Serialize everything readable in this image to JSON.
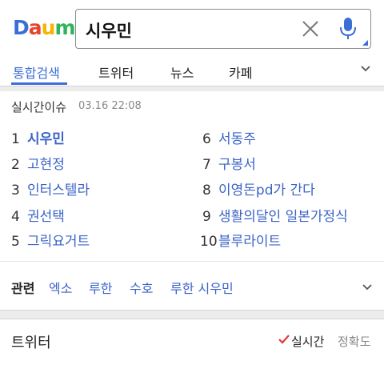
{
  "logo": {
    "letters": [
      "D",
      "a",
      "u",
      "m"
    ],
    "colors": [
      "#3b6fd6",
      "#e8432c",
      "#f5b400",
      "#2fb35b"
    ]
  },
  "search": {
    "query": "시우민"
  },
  "tabs": [
    {
      "label": "통합검색",
      "active": true
    },
    {
      "label": "트위터"
    },
    {
      "label": "뉴스"
    },
    {
      "label": "카페"
    }
  ],
  "realtime": {
    "title": "실시간이슈",
    "timestamp": "03.16 22:08",
    "items": [
      {
        "rank": "1",
        "keyword": "시우민"
      },
      {
        "rank": "2",
        "keyword": "고현정"
      },
      {
        "rank": "3",
        "keyword": "인터스텔라"
      },
      {
        "rank": "4",
        "keyword": "권선택"
      },
      {
        "rank": "5",
        "keyword": "그릭요거트"
      },
      {
        "rank": "6",
        "keyword": "서동주"
      },
      {
        "rank": "7",
        "keyword": "구봉서"
      },
      {
        "rank": "8",
        "keyword": "이영돈pd가 간다"
      },
      {
        "rank": "9",
        "keyword": "생활의달인 일본가정식"
      },
      {
        "rank": "10",
        "keyword": "블루라이트"
      }
    ]
  },
  "related": {
    "label": "관련",
    "items": [
      "엑소",
      "루한",
      "수호",
      "루한 시우민"
    ]
  },
  "twitter": {
    "title": "트위터",
    "sort_realtime": "실시간",
    "sort_accuracy": "정확도"
  },
  "colors": {
    "accent": "#3b6fd6",
    "link": "#3b63c8",
    "check": "#e03a3a"
  }
}
